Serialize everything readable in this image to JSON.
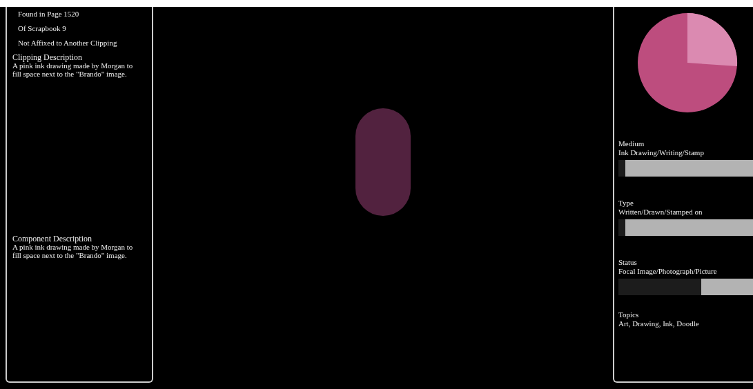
{
  "clipping_panel": {
    "facts": [
      "Found in Page 1520",
      "Of Scrapbook 9",
      "Not Affixed to Another Clipping"
    ],
    "sections": [
      {
        "heading": "Clipping Description",
        "text": "A pink ink drawing made by Morgan to fill space next to the \"Brando\" image."
      },
      {
        "heading": "Component Description",
        "text": "A pink ink drawing made by Morgan to fill space next to the \"Brando\" image."
      }
    ]
  },
  "attributes": [
    {
      "heading": "Medium",
      "value": "Ink Drawing/Writing/Stamp",
      "level": 0.05
    },
    {
      "heading": "Type",
      "value": "Written/Drawn/Stamped on",
      "level": 0.05
    },
    {
      "heading": "Status",
      "value": "Focal Image/Photograph/Picture",
      "level": 0.59
    },
    {
      "heading": "Topics",
      "value": "Art, Drawing, Ink, Doodle"
    }
  ]
}
